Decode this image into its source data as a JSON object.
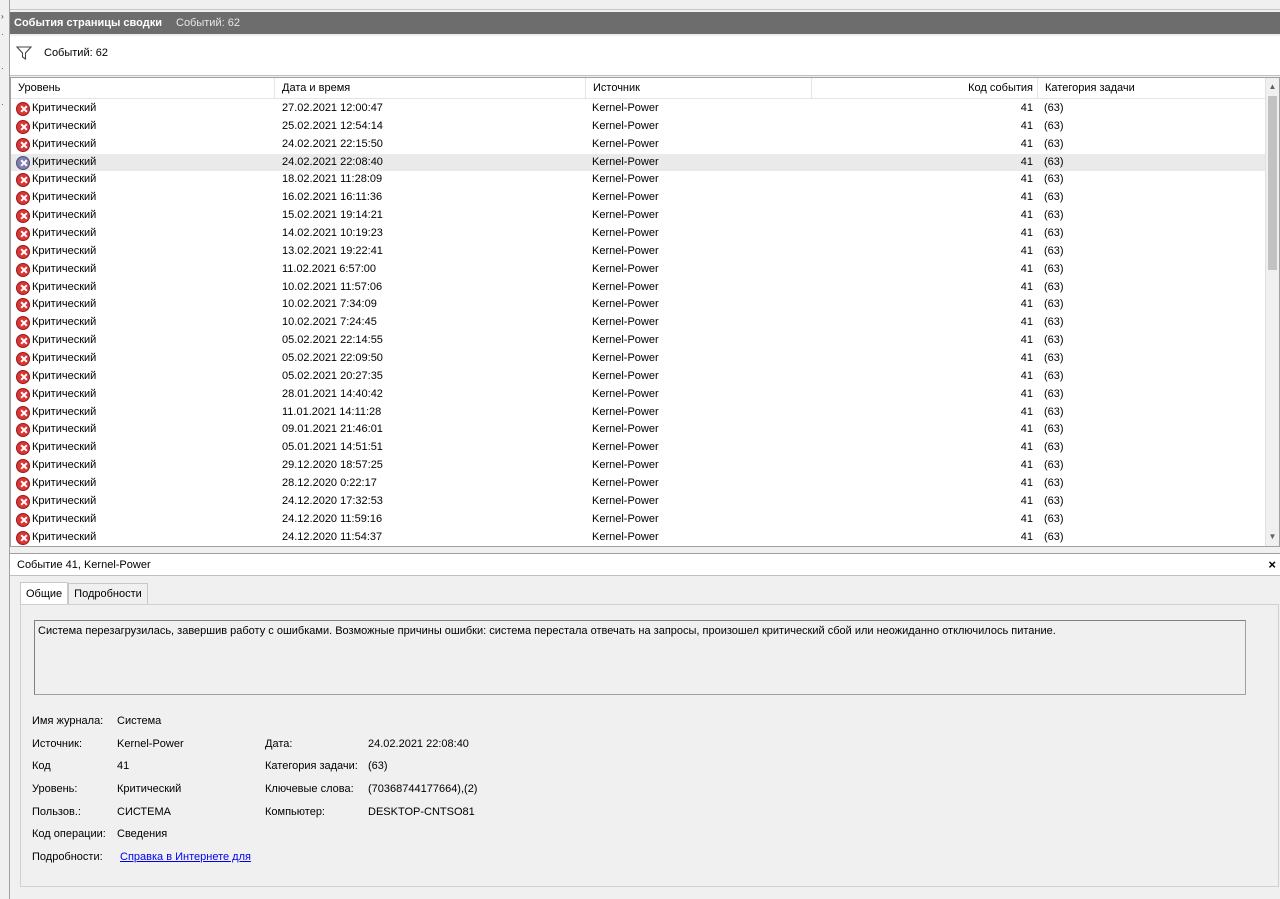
{
  "window": {
    "title": "События страницы сводки",
    "event_count_label": "Событий: 62"
  },
  "filter": {
    "count_label": "Событий: 62"
  },
  "grid": {
    "columns": {
      "level": "Уровень",
      "date": "Дата и время",
      "source": "Источник",
      "code": "Код события",
      "category": "Категория задачи"
    },
    "rows": [
      {
        "level": "Критический",
        "date": "27.02.2021 12:00:47",
        "source": "Kernel-Power",
        "code": "41",
        "category": "(63)"
      },
      {
        "level": "Критический",
        "date": "25.02.2021 12:54:14",
        "source": "Kernel-Power",
        "code": "41",
        "category": "(63)"
      },
      {
        "level": "Критический",
        "date": "24.02.2021 22:15:50",
        "source": "Kernel-Power",
        "code": "41",
        "category": "(63)"
      },
      {
        "level": "Критический",
        "date": "24.02.2021 22:08:40",
        "source": "Kernel-Power",
        "code": "41",
        "category": "(63)"
      },
      {
        "level": "Критический",
        "date": "18.02.2021 11:28:09",
        "source": "Kernel-Power",
        "code": "41",
        "category": "(63)"
      },
      {
        "level": "Критический",
        "date": "16.02.2021 16:11:36",
        "source": "Kernel-Power",
        "code": "41",
        "category": "(63)"
      },
      {
        "level": "Критический",
        "date": "15.02.2021 19:14:21",
        "source": "Kernel-Power",
        "code": "41",
        "category": "(63)"
      },
      {
        "level": "Критический",
        "date": "14.02.2021 10:19:23",
        "source": "Kernel-Power",
        "code": "41",
        "category": "(63)"
      },
      {
        "level": "Критический",
        "date": "13.02.2021 19:22:41",
        "source": "Kernel-Power",
        "code": "41",
        "category": "(63)"
      },
      {
        "level": "Критический",
        "date": "11.02.2021 6:57:00",
        "source": "Kernel-Power",
        "code": "41",
        "category": "(63)"
      },
      {
        "level": "Критический",
        "date": "10.02.2021 11:57:06",
        "source": "Kernel-Power",
        "code": "41",
        "category": "(63)"
      },
      {
        "level": "Критический",
        "date": "10.02.2021 7:34:09",
        "source": "Kernel-Power",
        "code": "41",
        "category": "(63)"
      },
      {
        "level": "Критический",
        "date": "10.02.2021 7:24:45",
        "source": "Kernel-Power",
        "code": "41",
        "category": "(63)"
      },
      {
        "level": "Критический",
        "date": "05.02.2021 22:14:55",
        "source": "Kernel-Power",
        "code": "41",
        "category": "(63)"
      },
      {
        "level": "Критический",
        "date": "05.02.2021 22:09:50",
        "source": "Kernel-Power",
        "code": "41",
        "category": "(63)"
      },
      {
        "level": "Критический",
        "date": "05.02.2021 20:27:35",
        "source": "Kernel-Power",
        "code": "41",
        "category": "(63)"
      },
      {
        "level": "Критический",
        "date": "28.01.2021 14:40:42",
        "source": "Kernel-Power",
        "code": "41",
        "category": "(63)"
      },
      {
        "level": "Критический",
        "date": "11.01.2021 14:11:28",
        "source": "Kernel-Power",
        "code": "41",
        "category": "(63)"
      },
      {
        "level": "Критический",
        "date": "09.01.2021 21:46:01",
        "source": "Kernel-Power",
        "code": "41",
        "category": "(63)"
      },
      {
        "level": "Критический",
        "date": "05.01.2021 14:51:51",
        "source": "Kernel-Power",
        "code": "41",
        "category": "(63)"
      },
      {
        "level": "Критический",
        "date": "29.12.2020 18:57:25",
        "source": "Kernel-Power",
        "code": "41",
        "category": "(63)"
      },
      {
        "level": "Критический",
        "date": "28.12.2020 0:22:17",
        "source": "Kernel-Power",
        "code": "41",
        "category": "(63)"
      },
      {
        "level": "Критический",
        "date": "24.12.2020 17:32:53",
        "source": "Kernel-Power",
        "code": "41",
        "category": "(63)"
      },
      {
        "level": "Критический",
        "date": "24.12.2020 11:59:16",
        "source": "Kernel-Power",
        "code": "41",
        "category": "(63)"
      },
      {
        "level": "Критический",
        "date": "24.12.2020 11:54:37",
        "source": "Kernel-Power",
        "code": "41",
        "category": "(63)"
      }
    ],
    "selected_row": 3
  },
  "details": {
    "header": "Событие 41, Kernel-Power",
    "close_glyph": "×",
    "tabs": [
      "Общие",
      "Подробности"
    ],
    "description": "Система перезагрузилась, завершив работу с ошибками. Возможные причины ошибки: система перестала отвечать на запросы, произошел критический сбой или неожиданно отключилось питание.",
    "props": {
      "log_label": "Имя журнала:",
      "log_value": "Система",
      "source_label": "Источник:",
      "source_value": "Kernel-Power",
      "date_label": "Дата:",
      "date_value": "24.02.2021 22:08:40",
      "code_label": "Код",
      "code_value": "41",
      "category_label": "Категория задачи:",
      "category_value": "(63)",
      "level_label": "Уровень:",
      "level_value": "Критический",
      "keywords_label": "Ключевые слова:",
      "keywords_value": "(70368744177664),(2)",
      "user_label": "Пользов.:",
      "user_value": "СИСТЕМА",
      "computer_label": "Компьютер:",
      "computer_value": "DESKTOP-CNTSO81",
      "opcode_label": "Код операции:",
      "opcode_value": "Сведения",
      "more_label": "Подробности:",
      "more_link": "Справка в Интернете для"
    }
  },
  "colors": {
    "title_bar": "#6d6d6d",
    "critical_icon": "#d93636",
    "selected_row": "#eaeaea",
    "link": "#0000ee"
  },
  "icons": {
    "critical": "critical-error-icon",
    "filter": "filter-funnel-icon",
    "close": "close-icon"
  }
}
